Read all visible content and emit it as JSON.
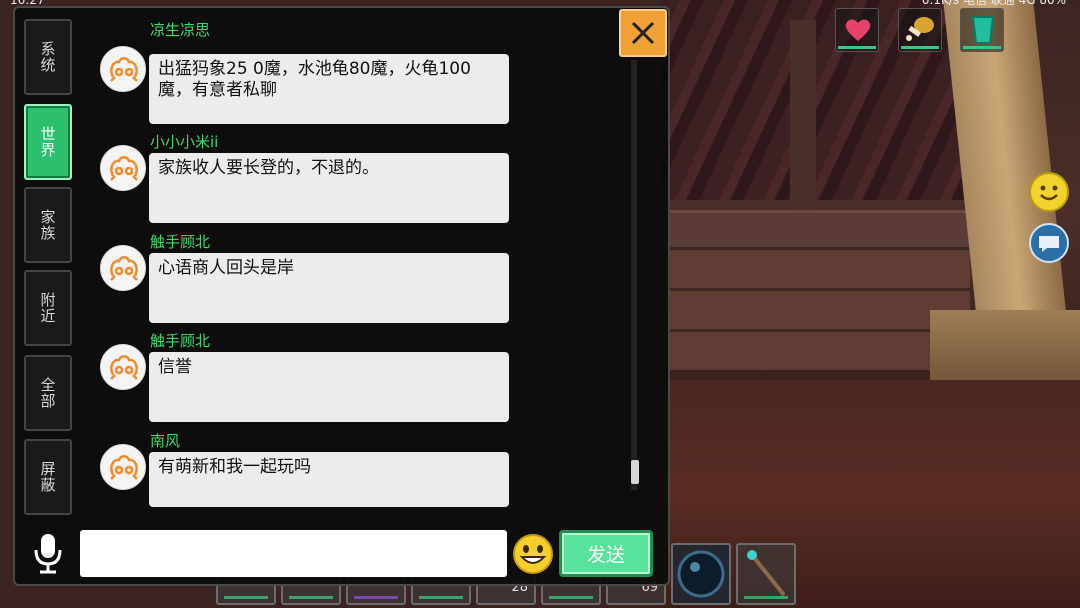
{
  "status_bar": {
    "time": "16:27",
    "right_text": "0.1K/s  电信  联通  4G  80%"
  },
  "tabs": [
    {
      "label": "系统",
      "active": false
    },
    {
      "label": "世界",
      "active": true
    },
    {
      "label": "家族",
      "active": false
    },
    {
      "label": "附近",
      "active": false
    },
    {
      "label": "全部",
      "active": false
    },
    {
      "label": "屏蔽",
      "active": false
    }
  ],
  "messages": [
    {
      "name": "凉生凉思",
      "text": "出猛犸象25 0魔，水池龟80魔，火龟100魔，有意者私聊"
    },
    {
      "name": "小小小米ii",
      "text": "家族收人要长登的，不退的。"
    },
    {
      "name": "触手顾北",
      "text": "心语商人回头是岸"
    },
    {
      "name": "触手顾北",
      "text": "信誉"
    },
    {
      "name": "南风",
      "text": "有萌新和我一起玩吗"
    }
  ],
  "input": {
    "value": "",
    "placeholder": ""
  },
  "send_label": "发送",
  "hotbar": {
    "counts": {
      "slot5": "28",
      "slot7": "69"
    }
  },
  "icons": {
    "close": "close-icon",
    "mic": "microphone-icon",
    "emoji": "smiley-emoji-icon",
    "health": "heart-icon",
    "hunger": "drumstick-icon",
    "water": "cup-icon",
    "expression": "smiley-face-icon",
    "chat": "chat-bubble-icon"
  },
  "colors": {
    "active_tab": "#2cc06e",
    "username": "#3fd86d",
    "send_button": "#57e39b",
    "close_button": "#f0a136",
    "bubble": "#ececec"
  }
}
